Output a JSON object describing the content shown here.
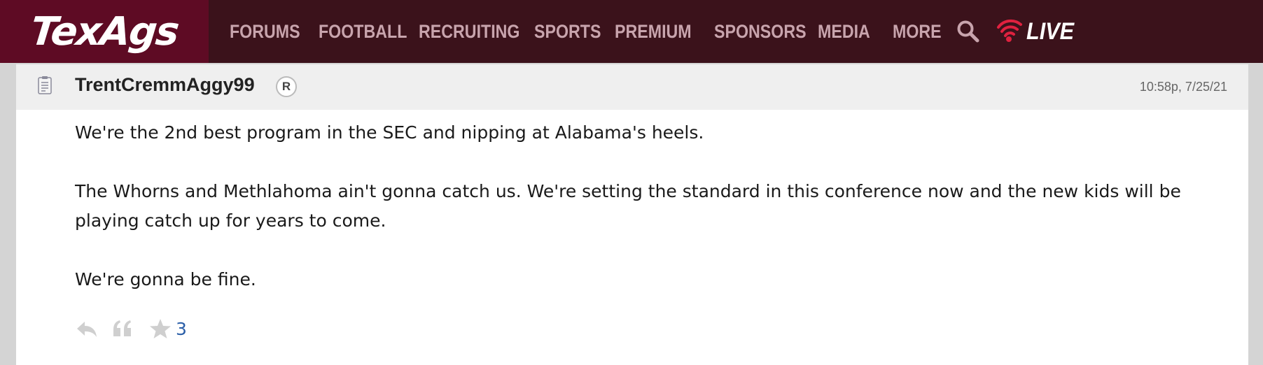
{
  "site": {
    "logo_text": "TexAgs"
  },
  "nav": {
    "items": [
      "FORUMS",
      "FOOTBALL",
      "RECRUITING",
      "SPORTS",
      "PREMIUM",
      "SPONSORS",
      "MEDIA",
      "MORE"
    ],
    "live_label": "LIVE",
    "search_icon": "search-icon",
    "live_icon": "wifi-icon"
  },
  "post": {
    "username": "TrentCremmAggy99",
    "badge": "R",
    "timestamp": "10:58p, 7/25/21",
    "paragraphs": [
      "We're the 2nd best program in the SEC and nipping at Alabama's heels.",
      "The Whorns and Methlahoma ain't gonna catch us. We're setting the standard in this conference now and the new kids will be playing catch up for years to come.",
      "We're gonna be fine."
    ],
    "star_count": "3",
    "icons": [
      "post-icon",
      "reply-icon",
      "quote-icon",
      "star-icon"
    ]
  },
  "colors": {
    "header_bg": "#3b121b",
    "logo_bg": "#5e0b24",
    "nav_text": "#c8a4ad",
    "live_accent": "#e0213f",
    "link_blue": "#2b5fa8"
  }
}
